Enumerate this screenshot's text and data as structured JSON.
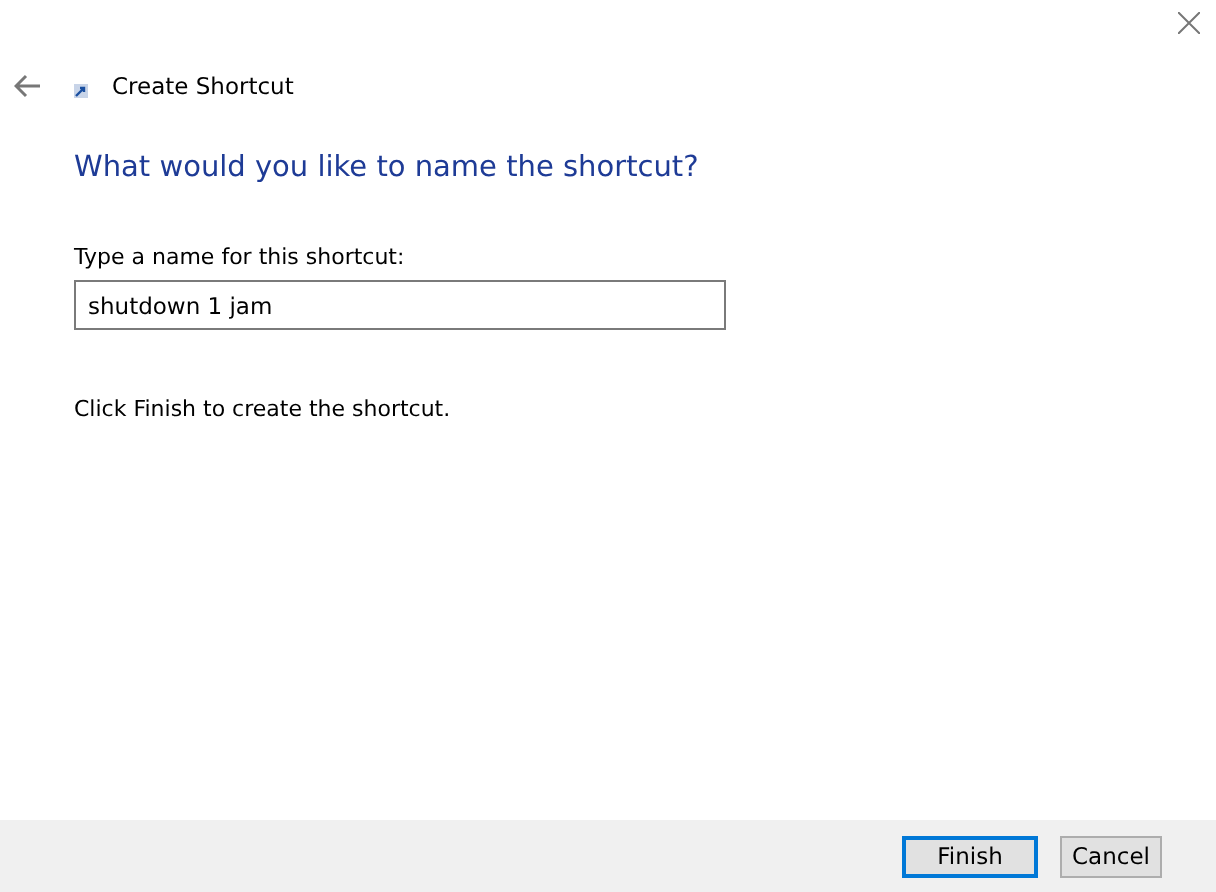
{
  "window": {
    "title": "Create Shortcut"
  },
  "heading": "What would you like to name the shortcut?",
  "name_field": {
    "label": "Type a name for this shortcut:",
    "value": "shutdown 1 jam"
  },
  "instruction": "Click Finish to create the shortcut.",
  "buttons": [
    {
      "label": "Finish",
      "kind": "default"
    },
    {
      "label": "Cancel",
      "kind": "normal"
    }
  ]
}
